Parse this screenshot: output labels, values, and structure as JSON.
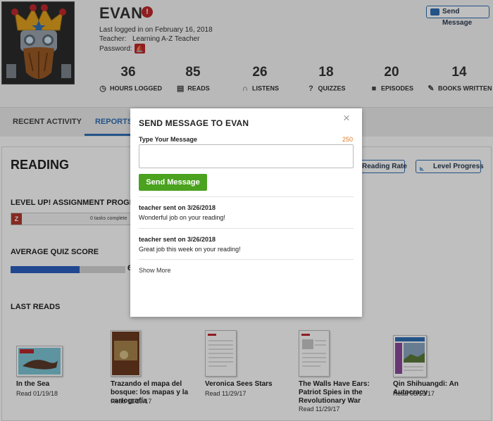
{
  "colors": {
    "accent": "#2f6fb4",
    "alert": "#c0282d",
    "send_green": "#4aa21f",
    "counter_orange": "#e07b23",
    "quiz_fill": "#2d5fc0"
  },
  "profile": {
    "name": "EVAN",
    "last_login": "Last logged in on February 16, 2018",
    "teacher_label": "Teacher:",
    "teacher_value": "Learning A-Z Teacher",
    "password_label": "Password:"
  },
  "header": {
    "send_message_label": "Send Message"
  },
  "stats": [
    {
      "value": "36",
      "label": "HOURS LOGGED",
      "icon": "clock-icon"
    },
    {
      "value": "85",
      "label": "READS",
      "icon": "book-icon"
    },
    {
      "value": "26",
      "label": "LISTENS",
      "icon": "headphones-icon"
    },
    {
      "value": "18",
      "label": "QUIZZES",
      "icon": "question-icon"
    },
    {
      "value": "20",
      "label": "EPISODES",
      "icon": "camera-icon"
    },
    {
      "value": "14",
      "label": "BOOKS WRITTEN",
      "icon": "pencil-icon"
    }
  ],
  "tabs": {
    "recent": "RECENT ACTIVITY",
    "reports": "REPORTS"
  },
  "reading": {
    "title": "READING",
    "reading_rate_label": "Reading Rate",
    "level_progress_label": "Level Progress",
    "levelup_title": "LEVEL UP! ASSIGNMENT PROGRE",
    "level_letter": "Z",
    "tasks_text": "0 tasks complete",
    "quiz_title": "AVERAGE QUIZ SCORE",
    "quiz_percent": 60,
    "quiz_digit": "6",
    "last_reads_title": "LAST READS"
  },
  "books": [
    {
      "title": "In the Sea",
      "date": "Read 01/19/18"
    },
    {
      "title": "Trazando el mapa del bosque: los mapas y la cartografía",
      "date": "Read 11/29/17"
    },
    {
      "title": "Veronica Sees Stars",
      "date": "Read 11/29/17"
    },
    {
      "title": "The Walls Have Ears: Patriot Spies in the Revolutionary War",
      "date": "Read 11/29/17"
    },
    {
      "title": "Qin Shihuangdi: An Autocracy",
      "date": "Read 08/15/17"
    }
  ],
  "modal": {
    "title": "SEND MESSAGE TO EVAN",
    "close": "×",
    "input_label": "Type Your Message",
    "char_count": "250",
    "input_value": "",
    "send_label": "Send Message",
    "messages": [
      {
        "header": "teacher sent on 3/26/2018",
        "body": "Wonderful job on your reading!"
      },
      {
        "header": "teacher sent on 3/26/2018",
        "body": "Great job this week on your reading!"
      }
    ],
    "show_more": "Show More"
  }
}
